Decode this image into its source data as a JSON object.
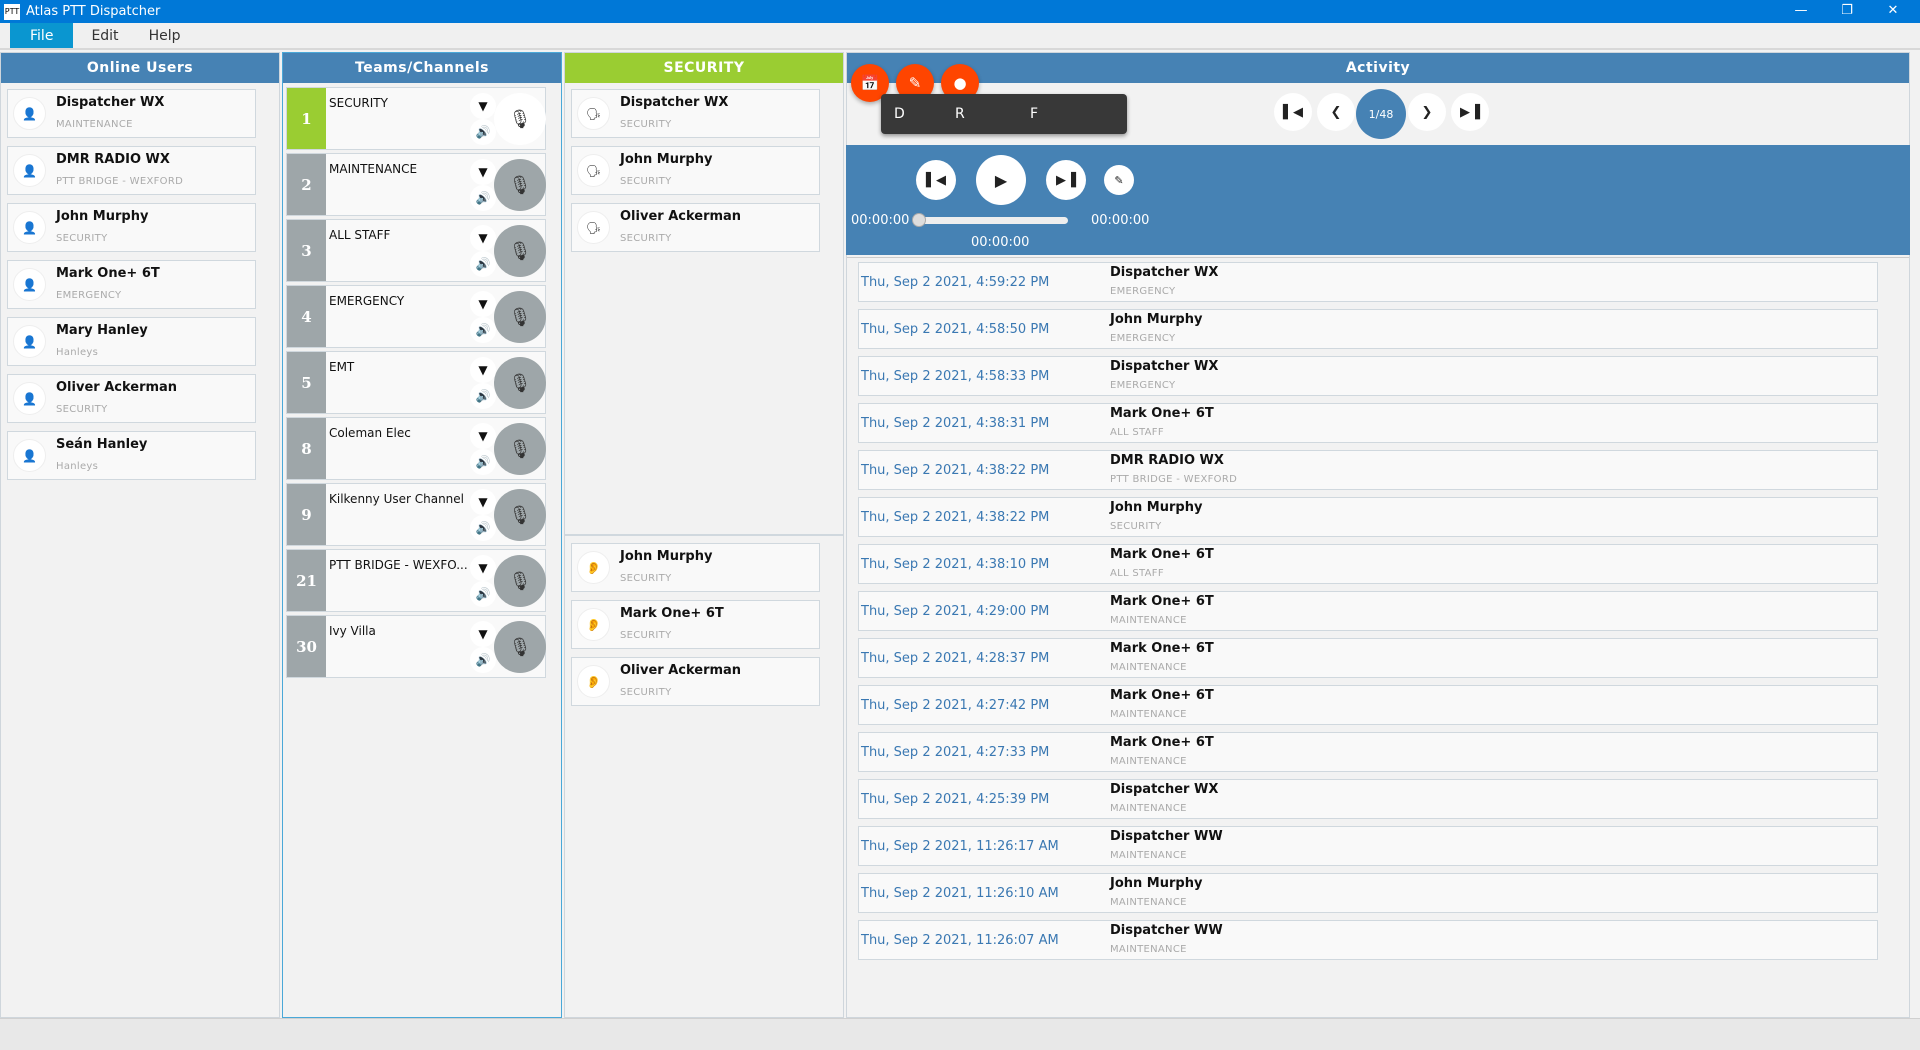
{
  "window": {
    "title": "Atlas PTT Dispatcher",
    "icon_text": "PTT"
  },
  "menu": [
    "File",
    "Edit",
    "Help"
  ],
  "online_users": {
    "title": "Online Users",
    "items": [
      {
        "name": "Dispatcher WX",
        "group": "MAINTENANCE"
      },
      {
        "name": "DMR RADIO WX",
        "group": "PTT BRIDGE - WEXFORD"
      },
      {
        "name": "John Murphy",
        "group": "SECURITY"
      },
      {
        "name": "Mark One+ 6T",
        "group": "EMERGENCY"
      },
      {
        "name": "Mary Hanley",
        "group": "Hanleys"
      },
      {
        "name": "Oliver Ackerman",
        "group": "SECURITY"
      },
      {
        "name": "Seán Hanley",
        "group": "Hanleys"
      }
    ]
  },
  "channels": {
    "title": "Teams/Channels",
    "items": [
      {
        "num": "1",
        "name": "SECURITY",
        "selected": true
      },
      {
        "num": "2",
        "name": "MAINTENANCE"
      },
      {
        "num": "3",
        "name": "ALL STAFF"
      },
      {
        "num": "4",
        "name": "EMERGENCY"
      },
      {
        "num": "5",
        "name": "EMT"
      },
      {
        "num": "8",
        "name": "Coleman Elec"
      },
      {
        "num": "9",
        "name": "Kilkenny User Channel"
      },
      {
        "num": "21",
        "name": "PTT BRIDGE - WEXFO..."
      },
      {
        "num": "30",
        "name": "Ivy Villa"
      }
    ]
  },
  "security": {
    "title": "SECURITY",
    "talkers": [
      {
        "name": "Dispatcher WX",
        "group": "SECURITY"
      },
      {
        "name": "John Murphy",
        "group": "SECURITY"
      },
      {
        "name": "Oliver Ackerman",
        "group": "SECURITY"
      }
    ],
    "listeners": [
      {
        "name": "John Murphy",
        "group": "SECURITY"
      },
      {
        "name": "Mark One+ 6T",
        "group": "SECURITY"
      },
      {
        "name": "Oliver Ackerman",
        "group": "SECURITY"
      }
    ]
  },
  "activity": {
    "title": "Activity",
    "tooltip": [
      "D",
      "R",
      "F"
    ],
    "page": "1/48",
    "player": {
      "current": "00:00:00",
      "total": "00:00:00",
      "position": "00:00:00",
      "progress": 0
    },
    "items": [
      {
        "time": "Thu, Sep 2 2021, 4:59:22 PM",
        "name": "Dispatcher WX",
        "group": "EMERGENCY"
      },
      {
        "time": "Thu, Sep 2 2021, 4:58:50 PM",
        "name": "John Murphy",
        "group": "EMERGENCY"
      },
      {
        "time": "Thu, Sep 2 2021, 4:58:33 PM",
        "name": "Dispatcher WX",
        "group": "EMERGENCY"
      },
      {
        "time": "Thu, Sep 2 2021, 4:38:31 PM",
        "name": "Mark One+ 6T",
        "group": "ALL STAFF"
      },
      {
        "time": "Thu, Sep 2 2021, 4:38:22 PM",
        "name": "DMR RADIO WX",
        "group": "PTT BRIDGE - WEXFORD"
      },
      {
        "time": "Thu, Sep 2 2021, 4:38:22 PM",
        "name": "John Murphy",
        "group": "SECURITY"
      },
      {
        "time": "Thu, Sep 2 2021, 4:38:10 PM",
        "name": "Mark One+ 6T",
        "group": "ALL STAFF"
      },
      {
        "time": "Thu, Sep 2 2021, 4:29:00 PM",
        "name": "Mark One+ 6T",
        "group": "MAINTENANCE"
      },
      {
        "time": "Thu, Sep 2 2021, 4:28:37 PM",
        "name": "Mark One+ 6T",
        "group": "MAINTENANCE"
      },
      {
        "time": "Thu, Sep 2 2021, 4:27:42 PM",
        "name": "Mark One+ 6T",
        "group": "MAINTENANCE"
      },
      {
        "time": "Thu, Sep 2 2021, 4:27:33 PM",
        "name": "Mark One+ 6T",
        "group": "MAINTENANCE"
      },
      {
        "time": "Thu, Sep 2 2021, 4:25:39 PM",
        "name": "Dispatcher WX",
        "group": "MAINTENANCE"
      },
      {
        "time": "Thu, Sep 2 2021, 11:26:17 AM",
        "name": "Dispatcher WW",
        "group": "MAINTENANCE"
      },
      {
        "time": "Thu, Sep 2 2021, 11:26:10 AM",
        "name": "John Murphy",
        "group": "MAINTENANCE"
      },
      {
        "time": "Thu, Sep 2 2021, 11:26:07 AM",
        "name": "Dispatcher WW",
        "group": "MAINTENANCE"
      }
    ]
  },
  "colors": {
    "accent": "#4682b4",
    "selected": "#9acd32",
    "fab": "#ff4500",
    "titlebar": "#0078d7"
  }
}
